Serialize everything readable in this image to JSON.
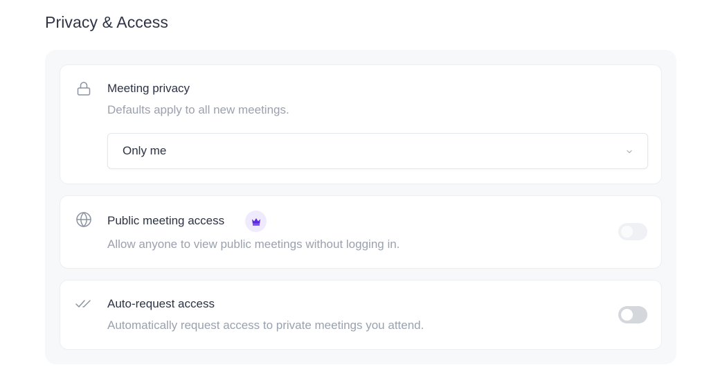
{
  "section": {
    "title": "Privacy & Access"
  },
  "meeting_privacy": {
    "icon": "lock-icon",
    "title": "Meeting privacy",
    "description": "Defaults apply to all new meetings.",
    "select": {
      "value": "Only me"
    }
  },
  "public_access": {
    "icon": "globe-icon",
    "title": "Public meeting access",
    "badge_icon": "crown-icon",
    "description": "Allow anyone to view public meetings without logging in.",
    "toggle": {
      "on": false,
      "disabled": true
    }
  },
  "auto_request": {
    "icon": "double-check-icon",
    "title": "Auto-request access",
    "description": "Automatically request access to private meetings you attend.",
    "toggle": {
      "on": false,
      "disabled": false
    }
  },
  "colors": {
    "accent": "#5b2be0",
    "badge_bg": "#efeafd",
    "text_primary": "#2b3243",
    "text_muted": "#9aa1ae",
    "panel_bg": "#f7f8fa",
    "toggle_off": "#d4d7dc"
  }
}
